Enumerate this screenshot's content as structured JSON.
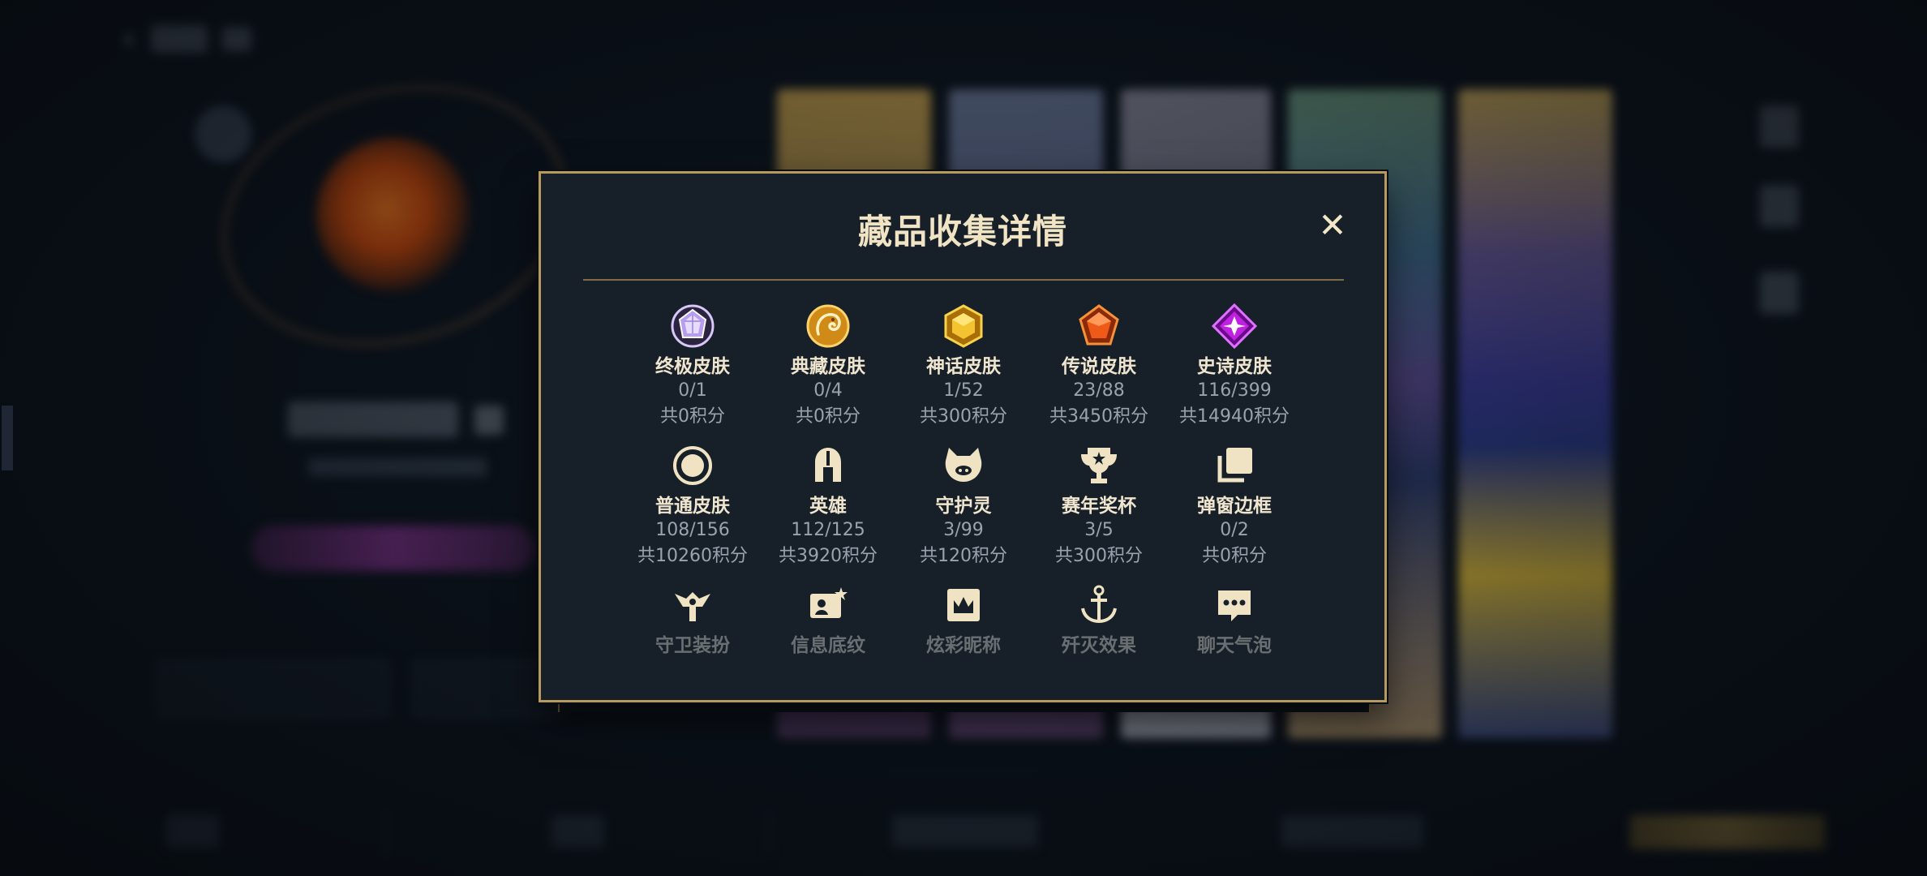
{
  "modal": {
    "title": "藏品收集详情",
    "close_label": "✕",
    "rows": [
      [
        {
          "name": "终极皮肤",
          "count": "0/1",
          "points": "共0积分",
          "icon": "ultimate-skin-icon"
        },
        {
          "name": "典藏皮肤",
          "count": "0/4",
          "points": "共0积分",
          "icon": "collection-skin-icon"
        },
        {
          "name": "神话皮肤",
          "count": "1/52",
          "points": "共300积分",
          "icon": "mythic-skin-icon"
        },
        {
          "name": "传说皮肤",
          "count": "23/88",
          "points": "共3450积分",
          "icon": "legendary-skin-icon"
        },
        {
          "name": "史诗皮肤",
          "count": "116/399",
          "points": "共14940积分",
          "icon": "epic-skin-icon"
        }
      ],
      [
        {
          "name": "普通皮肤",
          "count": "108/156",
          "points": "共10260积分",
          "icon": "normal-skin-icon"
        },
        {
          "name": "英雄",
          "count": "112/125",
          "points": "共3920积分",
          "icon": "helmet-icon"
        },
        {
          "name": "守护灵",
          "count": "3/99",
          "points": "共120积分",
          "icon": "guardian-spirit-icon"
        },
        {
          "name": "赛年奖杯",
          "count": "3/5",
          "points": "共300积分",
          "icon": "trophy-icon"
        },
        {
          "name": "弹窗边框",
          "count": "0/2",
          "points": "共0积分",
          "icon": "popup-frame-icon"
        }
      ],
      [
        {
          "name": "守卫装扮",
          "icon": "ward-skin-icon"
        },
        {
          "name": "信息底纹",
          "icon": "info-card-icon"
        },
        {
          "name": "炫彩昵称",
          "icon": "crown-nickname-icon"
        },
        {
          "name": "歼灭效果",
          "icon": "anchor-effect-icon"
        },
        {
          "name": "聊天气泡",
          "icon": "chat-bubble-icon"
        }
      ]
    ]
  },
  "colors": {
    "modal_bg": "#172029",
    "border_gold": "#b79a5e",
    "title": "#f1e4c4",
    "muted": "#9aa2ad"
  }
}
